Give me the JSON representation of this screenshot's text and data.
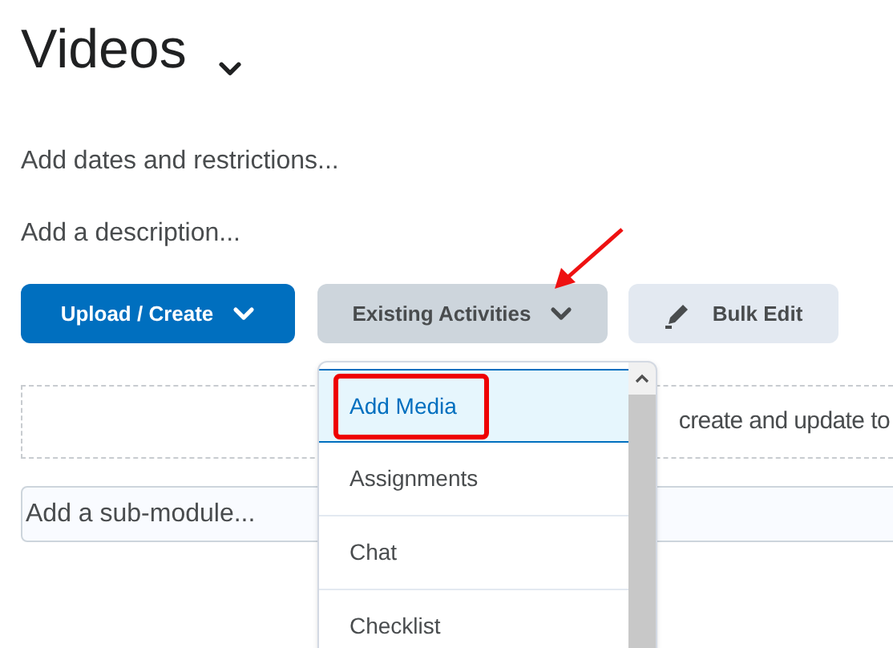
{
  "title": "Videos",
  "links": [
    "Add dates and restrictions...",
    "Add a description..."
  ],
  "buttons": [
    {
      "label": "Upload / Create",
      "kind": "primary"
    },
    {
      "label": "Existing Activities",
      "kind": "open"
    },
    {
      "label": "Bulk Edit",
      "kind": "edit"
    }
  ],
  "dropzone": {
    "text": "create and update to"
  },
  "submodule": {
    "placeholder": "Add a sub-module..."
  },
  "menu": {
    "items": [
      {
        "label": "Add Media",
        "selected": true
      },
      {
        "label": "Assignments",
        "selected": false
      },
      {
        "label": "Chat",
        "selected": false
      },
      {
        "label": "Checklist",
        "selected": false
      }
    ]
  }
}
